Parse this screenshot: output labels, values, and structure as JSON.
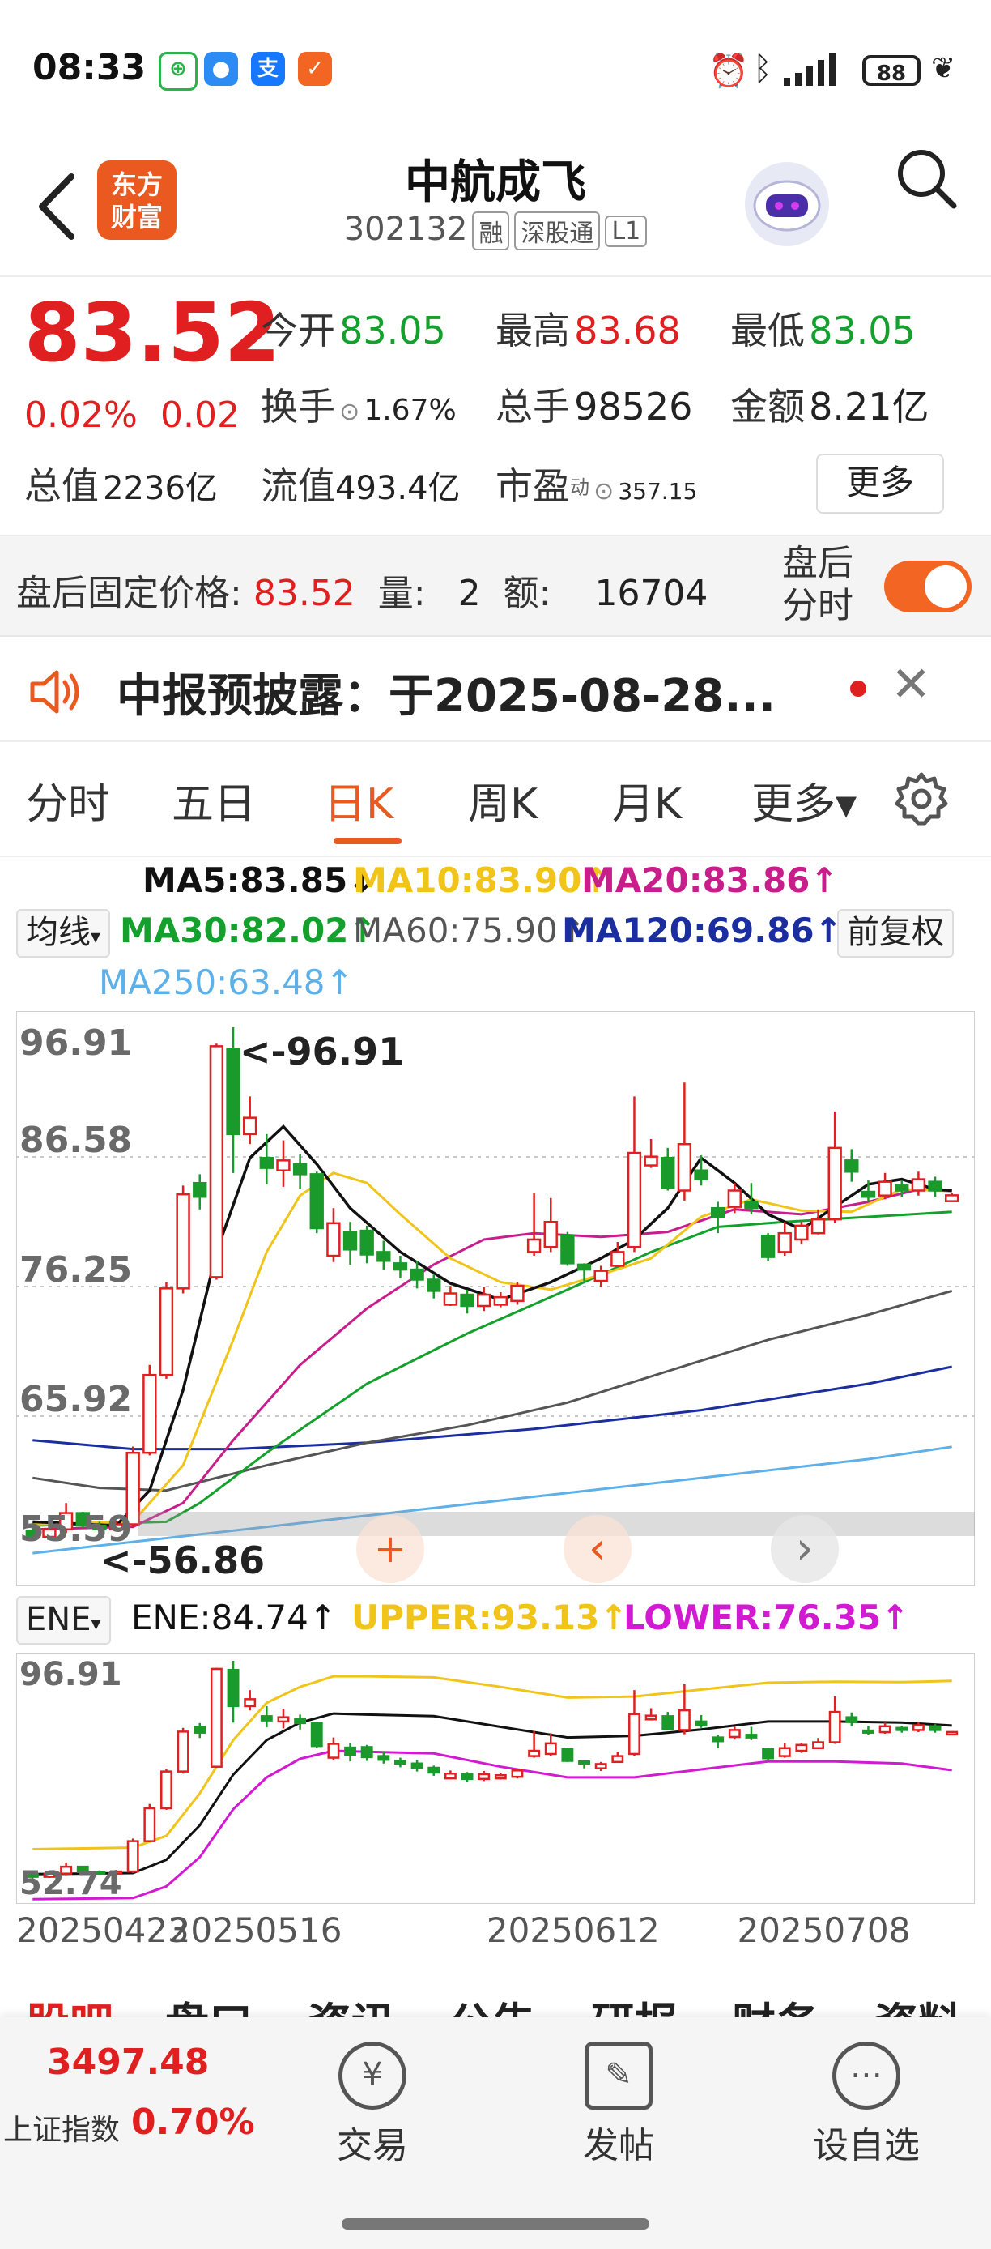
{
  "status": {
    "time": "08:33",
    "battery": "88"
  },
  "header": {
    "stock_name": "中航成飞",
    "code": "302132",
    "tags": [
      "融",
      "深股通",
      "L1"
    ],
    "logo_line1": "东方",
    "logo_line2": "财富"
  },
  "quote": {
    "price": "83.52",
    "change_pct": "0.02%",
    "change_amt": "0.02",
    "open_label": "今开",
    "open": "83.05",
    "high_label": "最高",
    "high": "83.68",
    "low_label": "最低",
    "low": "83.05",
    "turnover_label": "换手",
    "turnover": "1.67%",
    "volume_label": "总手",
    "volume": "98526",
    "amount_label": "金额",
    "amount": "8.21亿",
    "mktcap_label": "总值",
    "mktcap": "2236亿",
    "float_label": "流值",
    "float_cap": "493.4亿",
    "pe_label": "市盈",
    "pe_sup": "动",
    "pe": "357.15",
    "more": "更多"
  },
  "afterhours": {
    "label": "盘后固定价格:",
    "price": "83.52",
    "vol_label": "量:",
    "vol": "2",
    "amt_label": "额:",
    "amt": "16704",
    "toggle_label_1": "盘后",
    "toggle_label_2": "分时",
    "toggle_on": true
  },
  "notice": {
    "text": "中报预披露：于2025-08-28..."
  },
  "tabs": [
    "分时",
    "五日",
    "日K",
    "周K",
    "月K",
    "更多▾"
  ],
  "active_tab": "日K",
  "ma": {
    "ma5": "MA5:83.85↓",
    "ma10": "MA10:83.90↑",
    "ma20": "MA20:83.86↑",
    "selector": "均线",
    "ma30": "MA30:82.02↑",
    "ma60": "MA60:75.90↑",
    "ma120": "MA120:69.86↑",
    "ma250": "MA250:63.48↑",
    "adjust": "前复权",
    "colors": {
      "ma5": "#111111",
      "ma10": "#f0c419",
      "ma20": "#c81e8c",
      "ma30": "#14a02c",
      "ma60": "#555555",
      "ma120": "#1b2ea0",
      "ma250": "#5db0e8"
    }
  },
  "chart_data": [
    {
      "type": "candlestick",
      "y_ticks": [
        "96.91",
        "86.58",
        "76.25",
        "65.92",
        "55.59"
      ],
      "ylim": [
        55.59,
        96.91
      ],
      "annotations": [
        "<-96.91",
        "<-56.86"
      ],
      "candles": [
        {
          "o": 56.8,
          "c": 56.3,
          "h": 57.4,
          "l": 56.0
        },
        {
          "o": 56.3,
          "c": 56.9,
          "h": 57.2,
          "l": 56.1
        },
        {
          "o": 56.9,
          "c": 58.2,
          "h": 59.0,
          "l": 56.6
        },
        {
          "o": 58.2,
          "c": 57.2,
          "h": 58.3,
          "l": 57.0
        },
        {
          "o": 57.2,
          "c": 56.9,
          "h": 57.5,
          "l": 56.7
        },
        {
          "o": 56.9,
          "c": 57.3,
          "h": 57.6,
          "l": 56.8
        },
        {
          "o": 57.3,
          "c": 63.0,
          "h": 63.5,
          "l": 57.0
        },
        {
          "o": 63.0,
          "c": 69.2,
          "h": 70.0,
          "l": 62.8
        },
        {
          "o": 69.2,
          "c": 76.1,
          "h": 76.6,
          "l": 68.9
        },
        {
          "o": 76.1,
          "c": 83.6,
          "h": 84.3,
          "l": 75.7
        },
        {
          "o": 84.5,
          "c": 83.4,
          "h": 85.2,
          "l": 82.4
        },
        {
          "o": 77.0,
          "c": 95.4,
          "h": 95.6,
          "l": 76.8
        },
        {
          "o": 95.2,
          "c": 88.4,
          "h": 96.91,
          "l": 85.3
        },
        {
          "o": 88.4,
          "c": 89.7,
          "h": 91.4,
          "l": 87.6
        },
        {
          "o": 86.5,
          "c": 85.7,
          "h": 88.4,
          "l": 84.4
        },
        {
          "o": 85.5,
          "c": 86.3,
          "h": 87.9,
          "l": 84.2
        },
        {
          "o": 86.0,
          "c": 85.2,
          "h": 86.8,
          "l": 84.0
        },
        {
          "o": 85.2,
          "c": 80.9,
          "h": 85.4,
          "l": 80.5
        },
        {
          "o": 78.7,
          "c": 81.3,
          "h": 82.5,
          "l": 78.2
        },
        {
          "o": 80.6,
          "c": 79.2,
          "h": 81.4,
          "l": 78.0
        },
        {
          "o": 80.7,
          "c": 78.8,
          "h": 81.1,
          "l": 78.1
        },
        {
          "o": 79.0,
          "c": 78.3,
          "h": 79.9,
          "l": 77.6
        },
        {
          "o": 78.1,
          "c": 77.6,
          "h": 78.7,
          "l": 76.9
        },
        {
          "o": 77.6,
          "c": 76.8,
          "h": 78.3,
          "l": 76.1
        },
        {
          "o": 76.8,
          "c": 75.9,
          "h": 77.2,
          "l": 75.3
        },
        {
          "o": 74.8,
          "c": 75.7,
          "h": 76.3,
          "l": 74.7
        },
        {
          "o": 75.6,
          "c": 74.7,
          "h": 76.0,
          "l": 74.1
        },
        {
          "o": 74.7,
          "c": 75.6,
          "h": 76.2,
          "l": 74.3
        },
        {
          "o": 74.8,
          "c": 75.4,
          "h": 75.8,
          "l": 74.6
        },
        {
          "o": 75.1,
          "c": 76.3,
          "h": 76.6,
          "l": 74.8
        },
        {
          "o": 79.0,
          "c": 80.0,
          "h": 83.7,
          "l": 78.7
        },
        {
          "o": 79.4,
          "c": 81.4,
          "h": 83.3,
          "l": 79.0
        },
        {
          "o": 80.3,
          "c": 78.1,
          "h": 80.6,
          "l": 77.9
        },
        {
          "o": 78.0,
          "c": 77.6,
          "h": 78.1,
          "l": 76.7
        },
        {
          "o": 76.7,
          "c": 77.5,
          "h": 77.9,
          "l": 76.2
        },
        {
          "o": 77.9,
          "c": 79.0,
          "h": 79.8,
          "l": 77.8
        },
        {
          "o": 79.4,
          "c": 86.9,
          "h": 91.4,
          "l": 79.0
        },
        {
          "o": 85.9,
          "c": 86.6,
          "h": 88.0,
          "l": 85.7
        },
        {
          "o": 86.5,
          "c": 84.1,
          "h": 87.3,
          "l": 83.9
        },
        {
          "o": 83.9,
          "c": 87.6,
          "h": 92.5,
          "l": 83.1
        },
        {
          "o": 85.5,
          "c": 84.8,
          "h": 86.7,
          "l": 84.3
        },
        {
          "o": 82.5,
          "c": 81.8,
          "h": 83.0,
          "l": 80.5
        },
        {
          "o": 82.6,
          "c": 83.9,
          "h": 84.5,
          "l": 82.1
        },
        {
          "o": 83.0,
          "c": 82.5,
          "h": 84.5,
          "l": 82.0
        },
        {
          "o": 80.3,
          "c": 78.6,
          "h": 80.5,
          "l": 78.3
        },
        {
          "o": 79.0,
          "c": 80.5,
          "h": 81.4,
          "l": 78.7
        },
        {
          "o": 80.0,
          "c": 81.1,
          "h": 81.4,
          "l": 79.6
        },
        {
          "o": 80.5,
          "c": 81.6,
          "h": 82.4,
          "l": 80.4
        },
        {
          "o": 81.6,
          "c": 87.3,
          "h": 90.2,
          "l": 81.3
        },
        {
          "o": 86.3,
          "c": 85.4,
          "h": 87.2,
          "l": 84.6
        },
        {
          "o": 83.8,
          "c": 83.4,
          "h": 84.7,
          "l": 83.0
        },
        {
          "o": 83.5,
          "c": 84.6,
          "h": 85.3,
          "l": 83.2
        },
        {
          "o": 84.3,
          "c": 83.9,
          "h": 84.7,
          "l": 83.4
        },
        {
          "o": 83.9,
          "c": 84.8,
          "h": 85.4,
          "l": 83.5
        },
        {
          "o": 84.6,
          "c": 83.9,
          "h": 85.0,
          "l": 83.4
        },
        {
          "o": 83.05,
          "c": 83.52,
          "h": 83.68,
          "l": 83.05
        }
      ],
      "ma_lines": {
        "ma5": [
          [
            0,
            57.5
          ],
          [
            5,
            57.2
          ],
          [
            7,
            60.0
          ],
          [
            9,
            68.0
          ],
          [
            11,
            79.0
          ],
          [
            13,
            86.5
          ],
          [
            15,
            89.0
          ],
          [
            17,
            86.0
          ],
          [
            19,
            82.5
          ],
          [
            22,
            79.0
          ],
          [
            25,
            76.5
          ],
          [
            28,
            75.2
          ],
          [
            31,
            76.6
          ],
          [
            34,
            78.5
          ],
          [
            36,
            80.0
          ],
          [
            38,
            82.5
          ],
          [
            40,
            86.5
          ],
          [
            42,
            84.5
          ],
          [
            44,
            82.0
          ],
          [
            46,
            80.8
          ],
          [
            48,
            82.6
          ],
          [
            50,
            84.4
          ],
          [
            52,
            84.8
          ],
          [
            54,
            84.0
          ],
          [
            55,
            83.9
          ]
        ],
        "ma10": [
          [
            0,
            57.3
          ],
          [
            6,
            57.5
          ],
          [
            9,
            62.0
          ],
          [
            12,
            72.0
          ],
          [
            14,
            79.0
          ],
          [
            16,
            83.5
          ],
          [
            18,
            85.3
          ],
          [
            20,
            84.5
          ],
          [
            22,
            82.0
          ],
          [
            25,
            78.5
          ],
          [
            28,
            76.6
          ],
          [
            31,
            76.0
          ],
          [
            34,
            77.2
          ],
          [
            37,
            78.5
          ],
          [
            40,
            81.8
          ],
          [
            43,
            83.2
          ],
          [
            46,
            82.3
          ],
          [
            49,
            82.2
          ],
          [
            52,
            84.0
          ],
          [
            55,
            83.9
          ]
        ],
        "ma20": [
          [
            0,
            56.9
          ],
          [
            6,
            57.1
          ],
          [
            9,
            59.0
          ],
          [
            12,
            64.0
          ],
          [
            16,
            70.0
          ],
          [
            20,
            74.5
          ],
          [
            24,
            78.0
          ],
          [
            27,
            80.0
          ],
          [
            30,
            80.5
          ],
          [
            34,
            80.2
          ],
          [
            38,
            80.6
          ],
          [
            42,
            82.4
          ],
          [
            46,
            82.0
          ],
          [
            50,
            83.0
          ],
          [
            53,
            84.0
          ],
          [
            55,
            83.86
          ]
        ],
        "ma30": [
          [
            0,
            57.2
          ],
          [
            8,
            57.5
          ],
          [
            10,
            59.0
          ],
          [
            14,
            63.0
          ],
          [
            20,
            68.5
          ],
          [
            26,
            72.5
          ],
          [
            32,
            76.0
          ],
          [
            37,
            79.0
          ],
          [
            41,
            81.0
          ],
          [
            45,
            81.4
          ],
          [
            50,
            81.8
          ],
          [
            55,
            82.2
          ]
        ],
        "ma60": [
          [
            0,
            61.0
          ],
          [
            4,
            60.2
          ],
          [
            8,
            60.0
          ],
          [
            14,
            62.0
          ],
          [
            20,
            63.8
          ],
          [
            26,
            65.2
          ],
          [
            32,
            67.0
          ],
          [
            38,
            69.5
          ],
          [
            44,
            72.0
          ],
          [
            50,
            74.0
          ],
          [
            55,
            75.9
          ]
        ],
        "ma120": [
          [
            0,
            64.0
          ],
          [
            6,
            63.3
          ],
          [
            12,
            63.3
          ],
          [
            20,
            63.8
          ],
          [
            30,
            64.9
          ],
          [
            40,
            66.4
          ],
          [
            50,
            68.5
          ],
          [
            55,
            69.86
          ]
        ],
        "ma250": [
          [
            0,
            55.0
          ],
          [
            10,
            56.5
          ],
          [
            20,
            58.0
          ],
          [
            30,
            59.5
          ],
          [
            40,
            61.0
          ],
          [
            50,
            62.5
          ],
          [
            55,
            63.48
          ]
        ]
      }
    },
    {
      "type": "line",
      "name": "ENE",
      "selector": "ENE",
      "ene_label": "ENE:84.74↑",
      "upper_label": "UPPER:93.13↑",
      "lower_label": "LOWER:76.35↑",
      "y_ticks": [
        "96.91",
        "52.74"
      ],
      "ylim": [
        52.74,
        96.91
      ],
      "upper": [
        [
          0,
          61.5
        ],
        [
          6,
          61.8
        ],
        [
          8,
          64.0
        ],
        [
          10,
          72.0
        ],
        [
          12,
          82.0
        ],
        [
          14,
          89.0
        ],
        [
          16,
          92.0
        ],
        [
          18,
          94.0
        ],
        [
          20,
          94.0
        ],
        [
          24,
          93.8
        ],
        [
          28,
          92.0
        ],
        [
          32,
          90.0
        ],
        [
          36,
          90.2
        ],
        [
          40,
          91.5
        ],
        [
          44,
          92.8
        ],
        [
          48,
          93.0
        ],
        [
          52,
          92.9
        ],
        [
          55,
          93.13
        ]
      ],
      "ene": [
        [
          0,
          56.8
        ],
        [
          6,
          57.0
        ],
        [
          8,
          59.5
        ],
        [
          10,
          66.0
        ],
        [
          12,
          75.5
        ],
        [
          14,
          82.0
        ],
        [
          16,
          85.3
        ],
        [
          18,
          87.0
        ],
        [
          20,
          86.8
        ],
        [
          24,
          86.5
        ],
        [
          28,
          84.5
        ],
        [
          32,
          82.5
        ],
        [
          36,
          82.8
        ],
        [
          40,
          84.0
        ],
        [
          44,
          85.5
        ],
        [
          48,
          85.5
        ],
        [
          52,
          85.3
        ],
        [
          55,
          84.74
        ]
      ],
      "lower": [
        [
          0,
          52.1
        ],
        [
          6,
          52.3
        ],
        [
          8,
          54.5
        ],
        [
          10,
          60.0
        ],
        [
          12,
          69.0
        ],
        [
          14,
          75.0
        ],
        [
          16,
          78.5
        ],
        [
          18,
          80.0
        ],
        [
          20,
          79.8
        ],
        [
          24,
          79.5
        ],
        [
          28,
          77.0
        ],
        [
          32,
          75.0
        ],
        [
          36,
          75.0
        ],
        [
          40,
          76.5
        ],
        [
          44,
          78.0
        ],
        [
          48,
          78.0
        ],
        [
          52,
          77.6
        ],
        [
          55,
          76.35
        ]
      ],
      "x_ticks": [
        "20250423",
        "20250516",
        "20250612",
        "20250708"
      ]
    }
  ],
  "bottom_tabs": [
    "股吧",
    "盘口",
    "资讯",
    "公告",
    "研报",
    "财务",
    "资料"
  ],
  "index": {
    "value": "3497.48",
    "name": "上证指数",
    "pct": "0.70%"
  },
  "nav": [
    {
      "label": "交易",
      "icon": "trade-icon",
      "glyph": "¥"
    },
    {
      "label": "发帖",
      "icon": "compose-icon",
      "glyph": "✎"
    },
    {
      "label": "设自选",
      "icon": "more-dots-icon",
      "glyph": "⋯"
    }
  ],
  "chart_controls": {
    "plus": "+",
    "left": "‹",
    "right": "›"
  }
}
